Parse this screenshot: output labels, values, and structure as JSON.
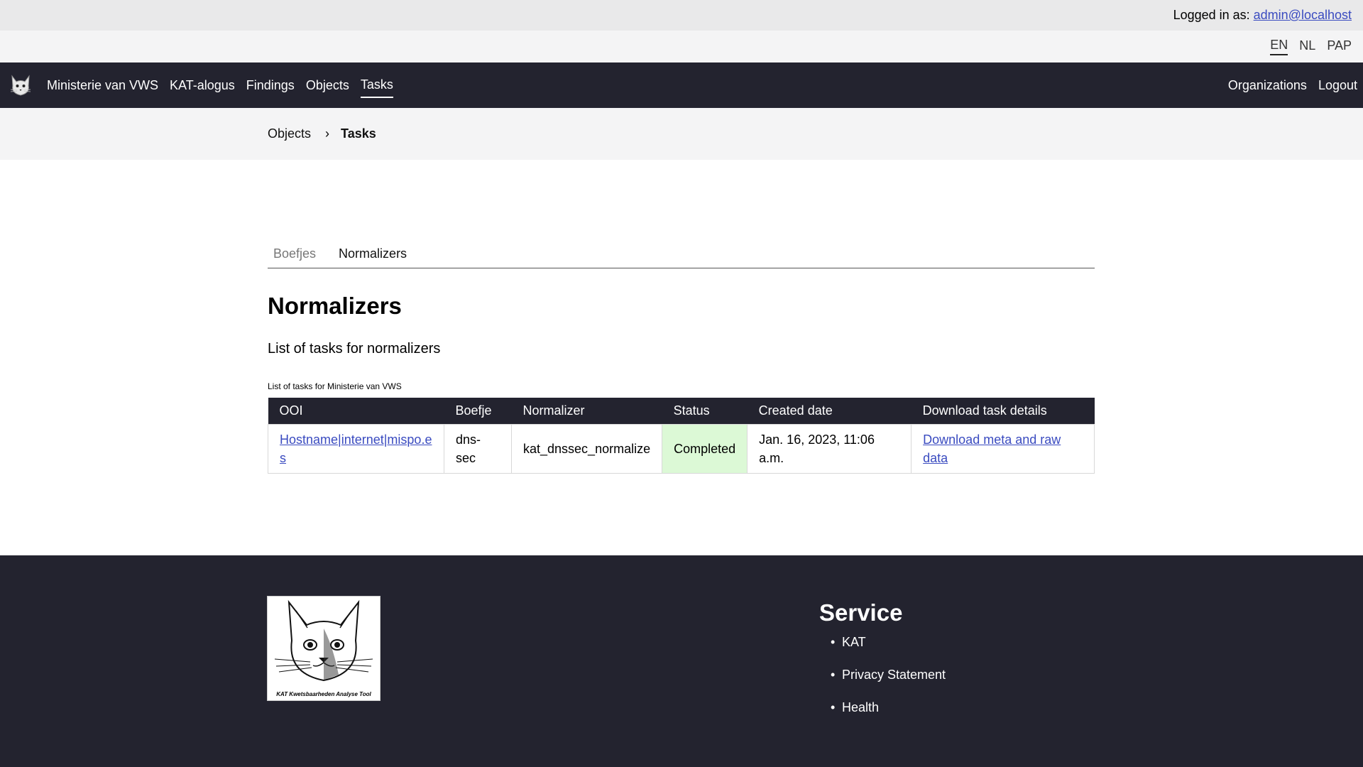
{
  "topbar": {
    "logged_in_label": "Logged in as:",
    "user": "admin@localhost"
  },
  "languages": [
    "EN",
    "NL",
    "PAP"
  ],
  "active_language": "EN",
  "nav": {
    "org": "Ministerie van VWS",
    "items": [
      "KAT-alogus",
      "Findings",
      "Objects",
      "Tasks"
    ],
    "active": "Tasks",
    "right": [
      "Organizations",
      "Logout"
    ]
  },
  "breadcrumb": {
    "parent": "Objects",
    "separator": "›",
    "current": "Tasks"
  },
  "tabs": {
    "items": [
      "Boefjes",
      "Normalizers"
    ],
    "active": "Normalizers"
  },
  "page": {
    "title": "Normalizers",
    "subtitle": "List of tasks for normalizers",
    "caption": "List of tasks for Ministerie van VWS"
  },
  "table": {
    "headers": [
      "OOI",
      "Boefje",
      "Normalizer",
      "Status",
      "Created date",
      "Download task details"
    ],
    "rows": [
      {
        "ooi": "Hostname|internet|mispo.es",
        "boefje": "dns-sec",
        "normalizer": "kat_dnssec_normalize",
        "status": "Completed",
        "created": "Jan. 16, 2023, 11:06 a.m.",
        "download": "Download meta and raw data"
      }
    ]
  },
  "footer": {
    "logo_caption": "KAT Kwetsbaarheden Analyse Tool",
    "service_title": "Service",
    "service_links": [
      "KAT",
      "Privacy Statement",
      "Health"
    ]
  },
  "colors": {
    "nav_bg": "#23232f",
    "link": "#3a4bc0",
    "status_completed_bg": "#dcf9d6"
  }
}
